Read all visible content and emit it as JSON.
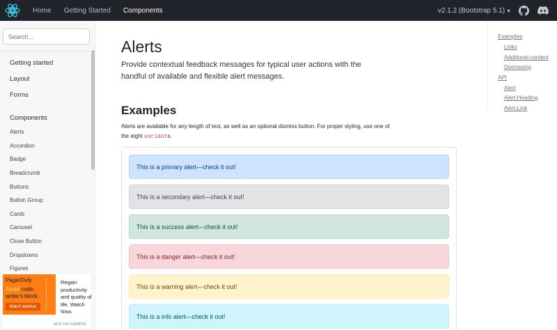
{
  "navbar": {
    "logo_icon": "react-bootstrap-logo-icon",
    "links": [
      "Home",
      "Getting Started",
      "Components"
    ],
    "version": "v2.1.2 (Bootstrap 5.1)",
    "github_icon": "github-icon",
    "discord_icon": "discord-icon"
  },
  "sidebar": {
    "search_placeholder": "Search...",
    "sections": [
      "Getting started",
      "Layout",
      "Forms"
    ],
    "components_heading": "Components",
    "items": [
      "Alerts",
      "Accordion",
      "Badge",
      "Breadcrumb",
      "Buttons",
      "Button Group",
      "Cards",
      "Carousel",
      "Close Button",
      "Dropdowns",
      "Figures"
    ]
  },
  "ad": {
    "brand": "PagerDuty",
    "line1_highlight": "Avoid",
    "line1_rest": " code-",
    "line2": "writer's block.",
    "button": "Watch webinar",
    "copy": "Regain productivity and quality of life. Watch Now.",
    "via": "ADS VIA CARBON"
  },
  "main": {
    "title": "Alerts",
    "lead": "Provide contextual feedback messages for typical user actions with the handful of available and flexible alert messages.",
    "examples_heading": "Examples",
    "para_before": "Alerts are available for any length of text, as well as an optional dismiss button. For proper styling, use one of the eight ",
    "para_code": "variant",
    "para_after": "s.",
    "alerts": [
      {
        "text": "This is a primary alert—check it out!",
        "bg": "#cfe2ff",
        "border": "#b6d4fe",
        "color": "#084298"
      },
      {
        "text": "This is a secondary alert—check it out!",
        "bg": "#e2e3e5",
        "border": "#d3d6d8",
        "color": "#41464b"
      },
      {
        "text": "This is a success alert—check it out!",
        "bg": "#d1e7dd",
        "border": "#badbcc",
        "color": "#0f5132"
      },
      {
        "text": "This is a danger alert—check it out!",
        "bg": "#f8d7da",
        "border": "#f5c2c7",
        "color": "#842029"
      },
      {
        "text": "This is a warning alert—check it out!",
        "bg": "#fff3cd",
        "border": "#ffecb5",
        "color": "#664d03"
      },
      {
        "text": "This is a info alert—check it out!",
        "bg": "#cff4fc",
        "border": "#b6effb",
        "color": "#055160"
      }
    ]
  },
  "toc": {
    "items": [
      "Examples",
      "Links",
      "Additional content",
      "Dismissing",
      "API",
      "Alert",
      "Alert.Heading",
      "Alert.Link"
    ]
  }
}
